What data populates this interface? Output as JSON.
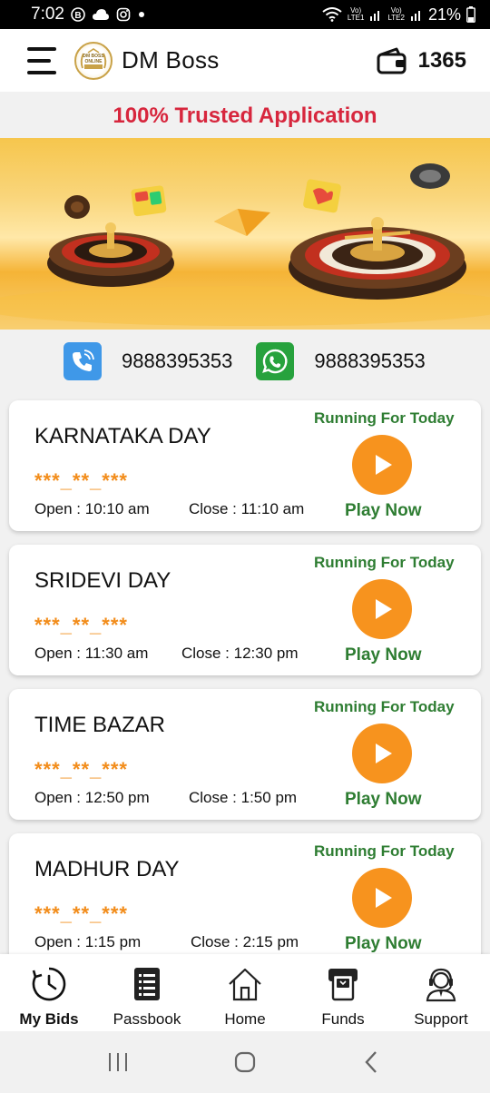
{
  "status_bar": {
    "time": "7:02",
    "network_1": "Vo)\nLTE1",
    "network_2": "Vo)\nLTE2",
    "battery": "21%"
  },
  "header": {
    "app_title": "DM Boss",
    "logo_text": "DM BOSS ONLINE",
    "wallet_balance": "1365"
  },
  "trusted_text": "100% Trusted Application",
  "contacts": {
    "phone": "9888395353",
    "whatsapp": "9888395353"
  },
  "games": [
    {
      "name": "KARNATAKA DAY",
      "result": "***_**_***",
      "open": "Open : 10:10 am",
      "close": "Close : 11:10 am",
      "status": "Running For Today",
      "action": "Play Now"
    },
    {
      "name": "SRIDEVI DAY",
      "result": "***_**_***",
      "open": "Open : 11:30 am",
      "close": "Close : 12:30 pm",
      "status": "Running For Today",
      "action": "Play Now"
    },
    {
      "name": "TIME BAZAR",
      "result": "***_**_***",
      "open": "Open : 12:50 pm",
      "close": "Close : 1:50 pm",
      "status": "Running For Today",
      "action": "Play Now"
    },
    {
      "name": "MADHUR DAY",
      "result": "***_**_***",
      "open": "Open : 1:15 pm",
      "close": "Close : 2:15 pm",
      "status": "Running For Today",
      "action": "Play Now"
    }
  ],
  "bottom_nav": [
    {
      "label": "My Bids",
      "icon": "history-icon",
      "active": true
    },
    {
      "label": "Passbook",
      "icon": "passbook-icon",
      "active": false
    },
    {
      "label": "Home",
      "icon": "home-icon",
      "active": false
    },
    {
      "label": "Funds",
      "icon": "funds-icon",
      "active": false
    },
    {
      "label": "Support",
      "icon": "support-icon",
      "active": false
    }
  ],
  "colors": {
    "accent_orange": "#f7931e",
    "status_green": "#2e7d32",
    "trusted_red": "#d7263d",
    "result_orange": "#f28c1a"
  }
}
